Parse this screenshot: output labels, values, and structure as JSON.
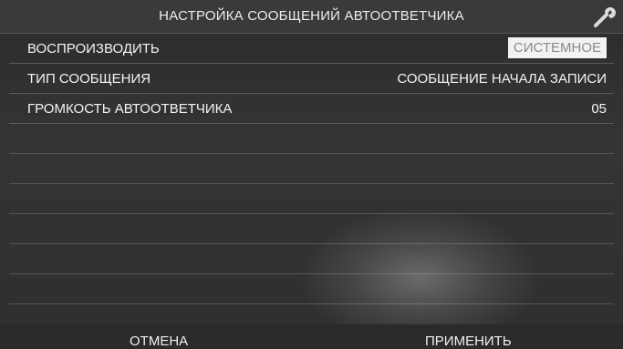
{
  "header": {
    "title": "НАСТРОЙКА СООБЩЕНИЙ АВТООТВЕТЧИКА",
    "icon": "wrench-icon"
  },
  "settings": [
    {
      "label": "ВОСПРОИЗВОДИТЬ",
      "value": "СИСТЕМНОЕ",
      "selected": true
    },
    {
      "label": "ТИП СООБЩЕНИЯ",
      "value": "СООБЩЕНИЕ НАЧАЛА ЗАПИСИ",
      "selected": false
    },
    {
      "label": "ГРОМКОСТЬ АВТООТВЕТЧИКА",
      "value": "05",
      "selected": false
    }
  ],
  "footer": {
    "cancel_label": "ОТМЕНА",
    "apply_label": "ПРИМЕНИТЬ"
  },
  "colors": {
    "background": "#2f2f2f",
    "text": "#f4f4f4",
    "selected_bg": "#f2f2f2",
    "selected_text": "#8a8a8a"
  }
}
